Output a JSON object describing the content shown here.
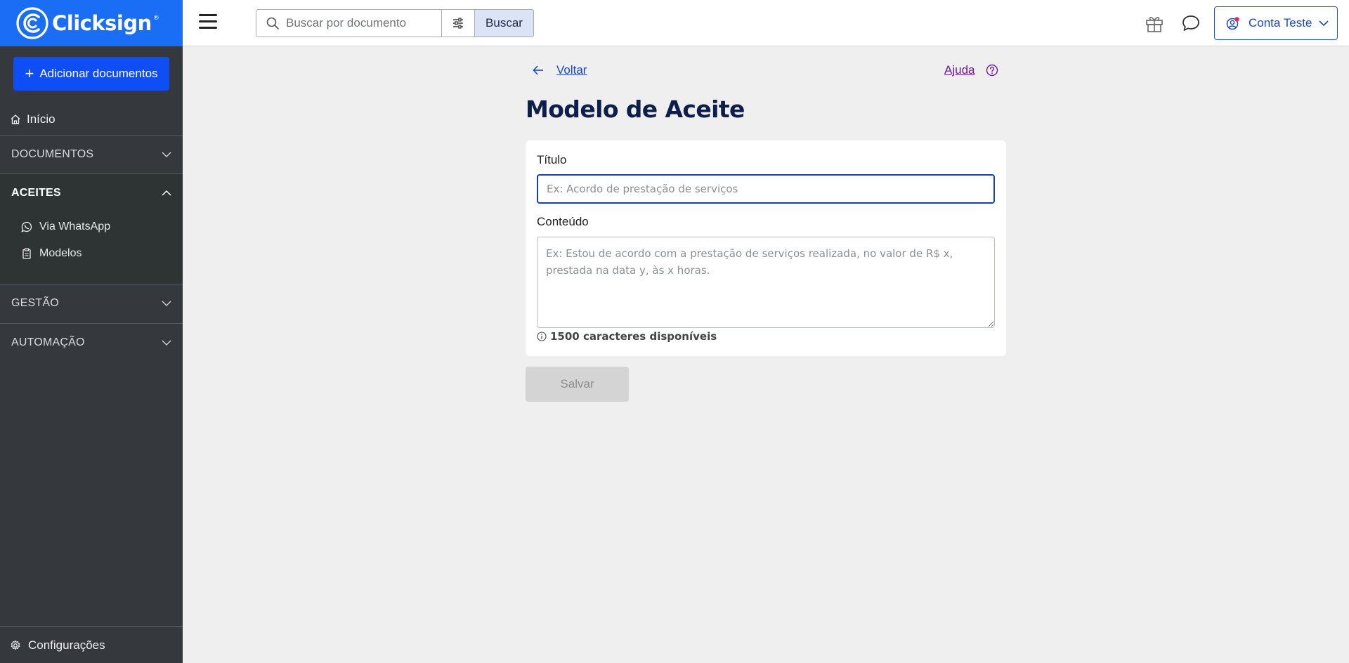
{
  "brand": {
    "name": "Clicksign",
    "tm": "®"
  },
  "search": {
    "placeholder": "Buscar por documento",
    "button_label": "Buscar"
  },
  "account": {
    "label": "Conta Teste"
  },
  "sidebar": {
    "add_documents_label": "Adicionar documentos",
    "home_label": "Início",
    "sections": {
      "documentos": "DOCUMENTOS",
      "aceites": "ACEITES",
      "gestao": "GESTÃO",
      "automacao": "AUTOMAÇÃO"
    },
    "aceites_items": {
      "whatsapp": "Via WhatsApp",
      "modelos": "Modelos"
    },
    "config_label": "Configurações"
  },
  "main": {
    "back_label": "Voltar",
    "help_label": "Ajuda",
    "title": "Modelo de Aceite",
    "form": {
      "title_label": "Título",
      "title_placeholder": "Ex: Acordo de prestação de serviços",
      "title_value": "",
      "content_label": "Conteúdo",
      "content_placeholder": "Ex: Estou de acordo com a prestação de serviços realizada, no valor de R$ x, prestada na data y, às x horas.",
      "content_value": "",
      "chars_available": "1500 caracteres disponíveis"
    },
    "save_label": "Salvar"
  },
  "colors": {
    "brand_blue": "#1a6ef5",
    "primary_button": "#0f4df5",
    "sidebar_bg": "#35383d",
    "title_navy": "#0b1f4a"
  },
  "icons": {
    "logo": "clicksign-logo-icon",
    "menu": "hamburger-icon",
    "search": "search-icon",
    "filter": "sliders-icon",
    "gift": "gift-icon",
    "chat": "chat-bubble-icon",
    "account": "user-circle-icon",
    "home": "home-icon",
    "whatsapp": "whatsapp-icon",
    "templates": "clipboard-icon",
    "settings": "gear-icon",
    "back": "arrow-left-icon",
    "help": "question-circle-icon",
    "info": "info-circle-icon"
  }
}
